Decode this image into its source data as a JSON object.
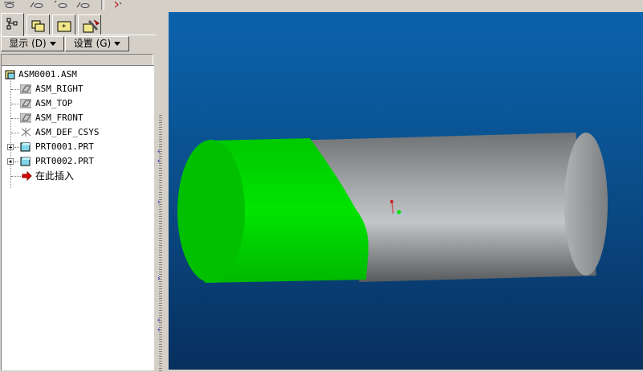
{
  "toolbar": {
    "buttons": [
      "view-tool-1",
      "view-tool-2",
      "view-tool-3",
      "view-tool-4",
      "view-tool-5"
    ]
  },
  "left_panel": {
    "tabs": [
      {
        "name": "model-tree-tab",
        "icon": "tree-structure-icon",
        "active": true
      },
      {
        "name": "folder-browser-tab",
        "icon": "folders-icon",
        "active": false
      },
      {
        "name": "favorites-tab",
        "icon": "favorites-folder-icon",
        "active": false
      },
      {
        "name": "connections-tab",
        "icon": "tools-icon",
        "active": false
      }
    ],
    "menu": {
      "show_label": "显示 (D)",
      "settings_label": "设置 (G)"
    },
    "filter_value": "",
    "tree": [
      {
        "label": "ASM0001.ASM",
        "icon": "assembly-icon",
        "expandable": false
      },
      {
        "label": "ASM_RIGHT",
        "icon": "datum-plane-icon",
        "expandable": false
      },
      {
        "label": "ASM_TOP",
        "icon": "datum-plane-icon",
        "expandable": false
      },
      {
        "label": "ASM_FRONT",
        "icon": "datum-plane-icon",
        "expandable": false
      },
      {
        "label": "ASM_DEF_CSYS",
        "icon": "coordinate-system-icon",
        "expandable": false
      },
      {
        "label": "PRT0001.PRT",
        "icon": "part-icon",
        "expandable": true
      },
      {
        "label": "PRT0002.PRT",
        "icon": "part-icon",
        "expandable": true
      },
      {
        "label": "在此插入",
        "icon": "insert-here-arrow-icon",
        "expandable": false
      }
    ]
  },
  "viewport": {
    "background_top": "#0b63ad",
    "background_bottom": "#082f5e",
    "model": {
      "description_colors": {
        "green_part": "#00e000",
        "gray_part": "#a9acae"
      },
      "triad_icon": "coordinate-triad-icon"
    }
  }
}
